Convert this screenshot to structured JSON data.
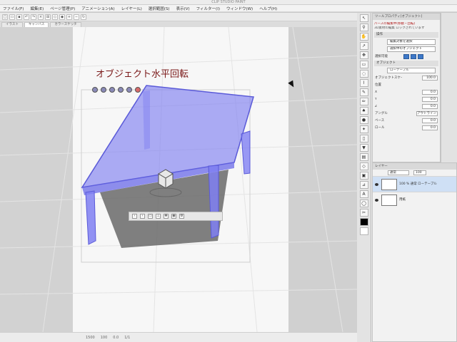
{
  "window": {
    "title": "CLIP STUDIO PAINT"
  },
  "menu": [
    "ファイル(F)",
    "編集(E)",
    "ページ管理(P)",
    "アニメーション(A)",
    "レイヤー(L)",
    "選択範囲(S)",
    "表示(V)",
    "フィルター(I)",
    "ウィンドウ(W)",
    "ヘルプ(H)"
  ],
  "tabs": [
    {
      "label": "イラスト"
    },
    {
      "label": "キャンバス"
    },
    {
      "label": "カラースケッチ"
    }
  ],
  "canvas": {
    "heading": "オブジェクト水平回転"
  },
  "tool_property": {
    "header": "ツールプロパティ[オブジェクト]",
    "note_red": "パースの編集中(移動・回転)",
    "note_sub": "3D素材の編集 ロックされています",
    "section_operation": "操作",
    "select_operation": "編集対象を選択",
    "select_object": "選択中のオブジェクト",
    "select_object_label": "選択可能",
    "section_object": "オブジェクト",
    "object_name": "ローテーブル",
    "object_scale_label": "オブジェクトスケール",
    "object_scale_value": "100.0",
    "position_label": "位置",
    "pos_x": "0.0",
    "pos_y": "0.0",
    "pos_z": "0.0",
    "angle_label": "アングル",
    "angle_value": "アウトライン",
    "base_label": "ベース",
    "base_value": "0.0",
    "roll_label": "ロール",
    "roll_value": "0.0"
  },
  "layers": {
    "header": "レイヤー",
    "blend_label": "通常",
    "opacity": "100",
    "items": [
      {
        "name": "100 % 通常 ローテーブル",
        "active": true
      },
      {
        "name": "用紙",
        "active": false
      }
    ]
  },
  "status": [
    "1500",
    "100",
    "0.0",
    "1/1"
  ],
  "colors": {
    "accent": "#3e78c8",
    "heading_text": "#7a1818",
    "object_fill": "#7b7bf0"
  }
}
